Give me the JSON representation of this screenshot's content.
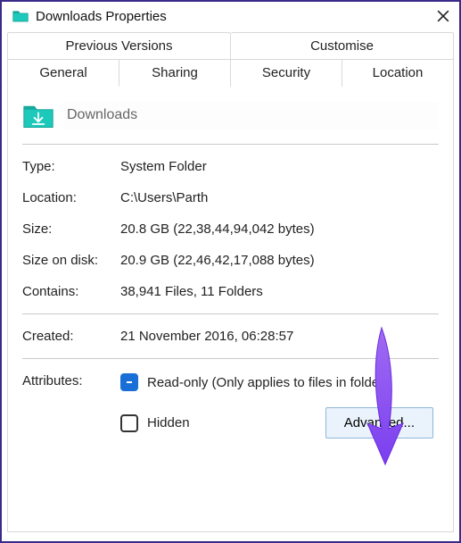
{
  "window": {
    "title": "Downloads Properties"
  },
  "tabs": {
    "row1": [
      "Previous Versions",
      "Customise"
    ],
    "row2": [
      "General",
      "Sharing",
      "Security",
      "Location"
    ],
    "active": "General"
  },
  "folder": {
    "name": "Downloads"
  },
  "props": {
    "type_label": "Type:",
    "type_value": "System Folder",
    "location_label": "Location:",
    "location_value": "C:\\Users\\Parth",
    "size_label": "Size:",
    "size_value": "20.8 GB (22,38,44,94,042 bytes)",
    "sod_label": "Size on disk:",
    "sod_value": "20.9 GB (22,46,42,17,088 bytes)",
    "contains_label": "Contains:",
    "contains_value": "38,941 Files, 11 Folders",
    "created_label": "Created:",
    "created_value": "21 November 2016, 06:28:57"
  },
  "attributes": {
    "label": "Attributes:",
    "readonly_label": "Read-only (Only applies to files in folder)",
    "readonly_checked": true,
    "hidden_label": "Hidden",
    "hidden_checked": false,
    "advanced_label": "Advanced..."
  }
}
